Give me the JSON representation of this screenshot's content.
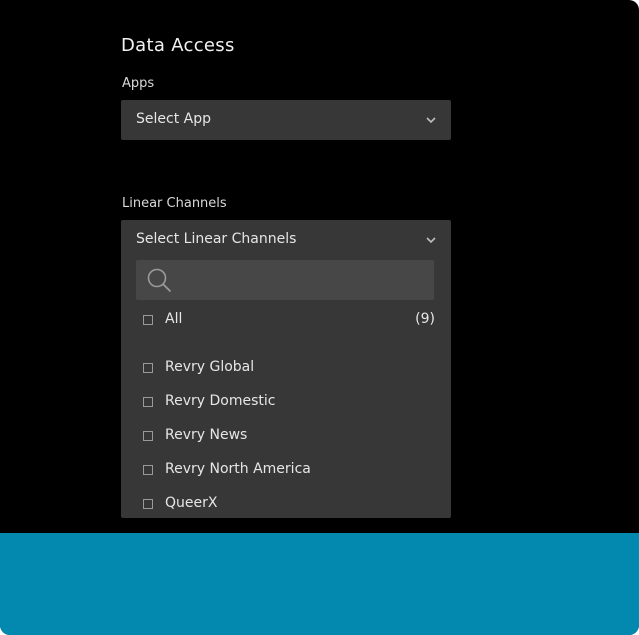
{
  "section": {
    "title": "Data Access"
  },
  "apps": {
    "label": "Apps",
    "placeholder": "Select App"
  },
  "linear_channels": {
    "label": "Linear Channels",
    "placeholder": "Select Linear Channels",
    "search_placeholder": "",
    "all_option": {
      "label": "All",
      "count": "(9)"
    },
    "options": [
      {
        "label": "Revry Global"
      },
      {
        "label": "Revry Domestic"
      },
      {
        "label": "Revry News"
      },
      {
        "label": "Revry North America"
      },
      {
        "label": "QueerX"
      }
    ]
  },
  "colors": {
    "background": "#000000",
    "panel": "#373737",
    "search_field": "#474747",
    "footer": "#0389b0",
    "text": "#e6e6e6"
  },
  "icons": {
    "chevron": "chevron-down-icon",
    "search": "search-icon",
    "checkbox": "checkbox-icon"
  }
}
